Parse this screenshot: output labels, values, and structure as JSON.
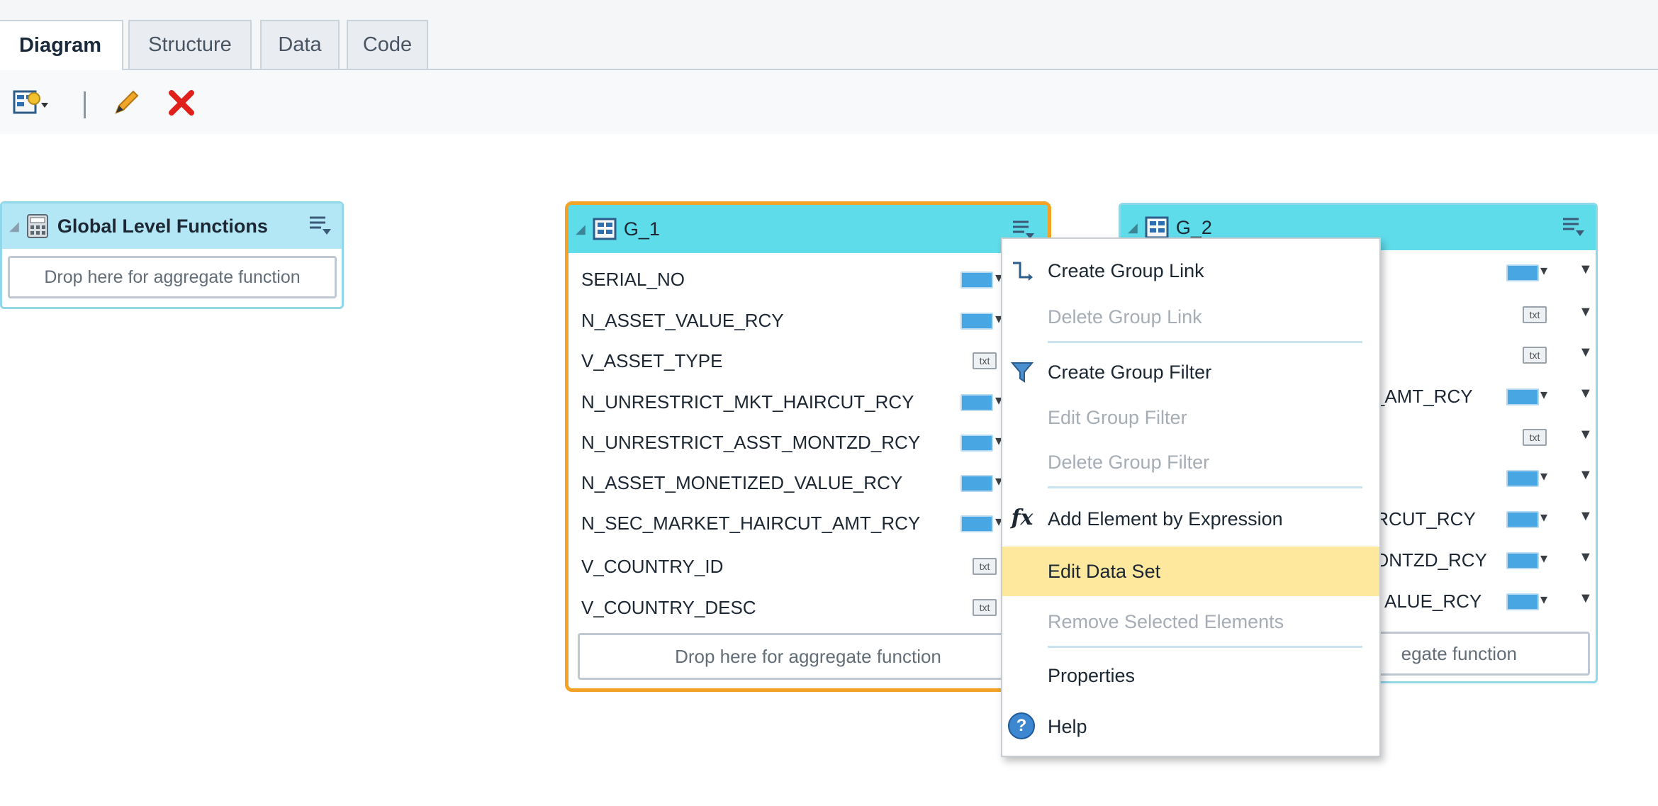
{
  "tabs": [
    {
      "label": "Diagram",
      "active": true
    },
    {
      "label": "Structure",
      "active": false
    },
    {
      "label": "Data",
      "active": false
    },
    {
      "label": "Code",
      "active": false
    }
  ],
  "toolbar": {
    "icons": [
      "data-set-icon",
      "pencil-icon",
      "delete-x-icon"
    ]
  },
  "global_panel": {
    "title": "Global Level Functions",
    "drop_text": "Drop here for aggregate function"
  },
  "g1": {
    "title": "G_1",
    "rows": [
      {
        "name": "SERIAL_NO",
        "type": "num"
      },
      {
        "name": "N_ASSET_VALUE_RCY",
        "type": "num"
      },
      {
        "name": "V_ASSET_TYPE",
        "type": "txt"
      },
      {
        "name": "N_UNRESTRICT_MKT_HAIRCUT_RCY",
        "type": "num"
      },
      {
        "name": "N_UNRESTRICT_ASST_MONTZD_RCY",
        "type": "num"
      },
      {
        "name": "N_ASSET_MONETIZED_VALUE_RCY",
        "type": "num"
      },
      {
        "name": "N_SEC_MARKET_HAIRCUT_AMT_RCY",
        "type": "num"
      },
      {
        "name": "V_COUNTRY_ID",
        "type": "txt"
      },
      {
        "name": "V_COUNTRY_DESC",
        "type": "txt"
      }
    ],
    "drop_text": "Drop here for aggregate function"
  },
  "g2": {
    "title": "G_2",
    "rows": [
      {
        "name": "",
        "type": "num"
      },
      {
        "name": "",
        "type": "txt"
      },
      {
        "name": "",
        "type": "txt"
      },
      {
        "name": "T_AMT_RCY",
        "type": "num"
      },
      {
        "name": "",
        "type": "txt"
      },
      {
        "name": "",
        "type": "num"
      },
      {
        "name": "IRCUT_RCY",
        "type": "num"
      },
      {
        "name": "ONTZD_RCY",
        "type": "num"
      },
      {
        "name": "ALUE_RCY",
        "type": "num"
      }
    ],
    "drop_text": "egate function"
  },
  "badge_text": "txt",
  "context_menu": {
    "items": [
      {
        "label": "Create Group Link",
        "enabled": true,
        "icon": "group-link-icon"
      },
      {
        "label": "Delete Group Link",
        "enabled": false
      },
      {
        "label": "Create Group Filter",
        "enabled": true,
        "icon": "filter-icon"
      },
      {
        "label": "Edit Group Filter",
        "enabled": false
      },
      {
        "label": "Delete Group Filter",
        "enabled": false
      },
      {
        "label": "Add Element by Expression",
        "enabled": true,
        "icon": "fx-icon",
        "icon_text": "fx"
      },
      {
        "label": "Edit Data Set",
        "enabled": true,
        "highlighted": true
      },
      {
        "label": "Remove Selected Elements",
        "enabled": false
      },
      {
        "label": "Properties",
        "enabled": true
      },
      {
        "label": "Help",
        "enabled": true,
        "icon": "help-icon",
        "icon_text": "?"
      }
    ]
  },
  "colors": {
    "g1_border": "#f2a325",
    "group_header": "#5fdcea",
    "highlight": "#fde89d",
    "delete_red": "#e0201b"
  }
}
